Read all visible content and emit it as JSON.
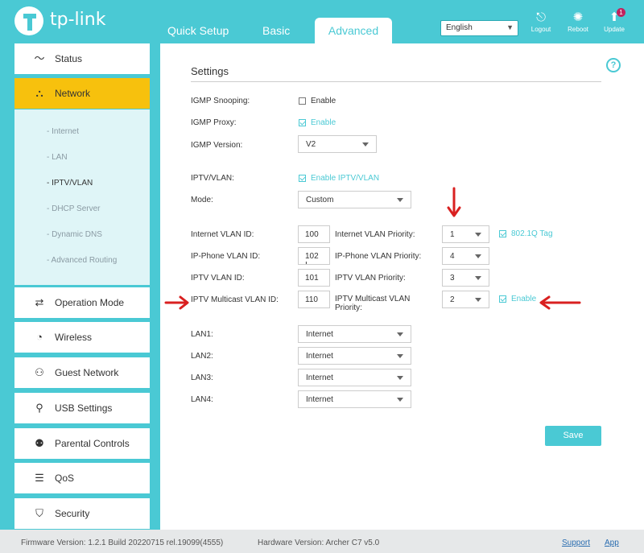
{
  "header": {
    "brand": "tp-link",
    "tabs": [
      "Quick Setup",
      "Basic",
      "Advanced"
    ],
    "language": "English",
    "actions": {
      "logout": "Logout",
      "reboot": "Reboot",
      "update": "Update",
      "update_badge": "1"
    }
  },
  "sidebar": {
    "items": [
      "Status",
      "Network",
      "Operation Mode",
      "Wireless",
      "Guest Network",
      "USB Settings",
      "Parental Controls",
      "QoS",
      "Security"
    ],
    "network_sub": [
      "- Internet",
      "- LAN",
      "- IPTV/VLAN",
      "- DHCP Server",
      "- Dynamic DNS",
      "- Advanced Routing"
    ]
  },
  "main": {
    "help": "?",
    "title": "Settings",
    "igmp_snooping_label": "IGMP Snooping:",
    "igmp_snooping_enable": "Enable",
    "igmp_proxy_label": "IGMP Proxy:",
    "igmp_proxy_enable": "Enable",
    "igmp_version_label": "IGMP Version:",
    "igmp_version_value": "V2",
    "iptv_vlan_label": "IPTV/VLAN:",
    "iptv_vlan_enable": "Enable IPTV/VLAN",
    "mode_label": "Mode:",
    "mode_value": "Custom",
    "internet_vlan_id_label": "Internet VLAN ID:",
    "internet_vlan_id_value": "100",
    "internet_vlan_priority_label": "Internet VLAN Priority:",
    "internet_vlan_priority_value": "1",
    "tag_label": "802.1Q Tag",
    "ipphone_vlan_id_label": "IP-Phone VLAN ID:",
    "ipphone_vlan_id_value": "102 I",
    "ipphone_vlan_priority_label": "IP-Phone VLAN Priority:",
    "ipphone_vlan_priority_value": "4",
    "iptv_vlan_id_label": "IPTV VLAN ID:",
    "iptv_vlan_id_value": "101",
    "iptv_vlan_priority_label": "IPTV VLAN Priority:",
    "iptv_vlan_priority_value": "3",
    "iptv_multicast_id_label": "IPTV Multicast VLAN ID:",
    "iptv_multicast_id_value": "110",
    "iptv_multicast_priority_label_1": "IPTV Multicast VLAN",
    "iptv_multicast_priority_label_2": "Priority:",
    "iptv_multicast_priority_value": "2",
    "multicast_enable": "Enable",
    "lan1_label": "LAN1:",
    "lan1_value": "Internet",
    "lan2_label": "LAN2:",
    "lan2_value": "Internet",
    "lan3_label": "LAN3:",
    "lan3_value": "Internet",
    "lan4_label": "LAN4:",
    "lan4_value": "Internet",
    "save": "Save"
  },
  "footer": {
    "firmware": "Firmware Version: 1.2.1 Build 20220715 rel.19099(4555)",
    "hardware": "Hardware Version: Archer C7 v5.0",
    "support": "Support",
    "app": "App"
  },
  "colors": {
    "accent": "#4ac9d4",
    "active_nav": "#f7c10d",
    "annotation": "#d92020"
  }
}
